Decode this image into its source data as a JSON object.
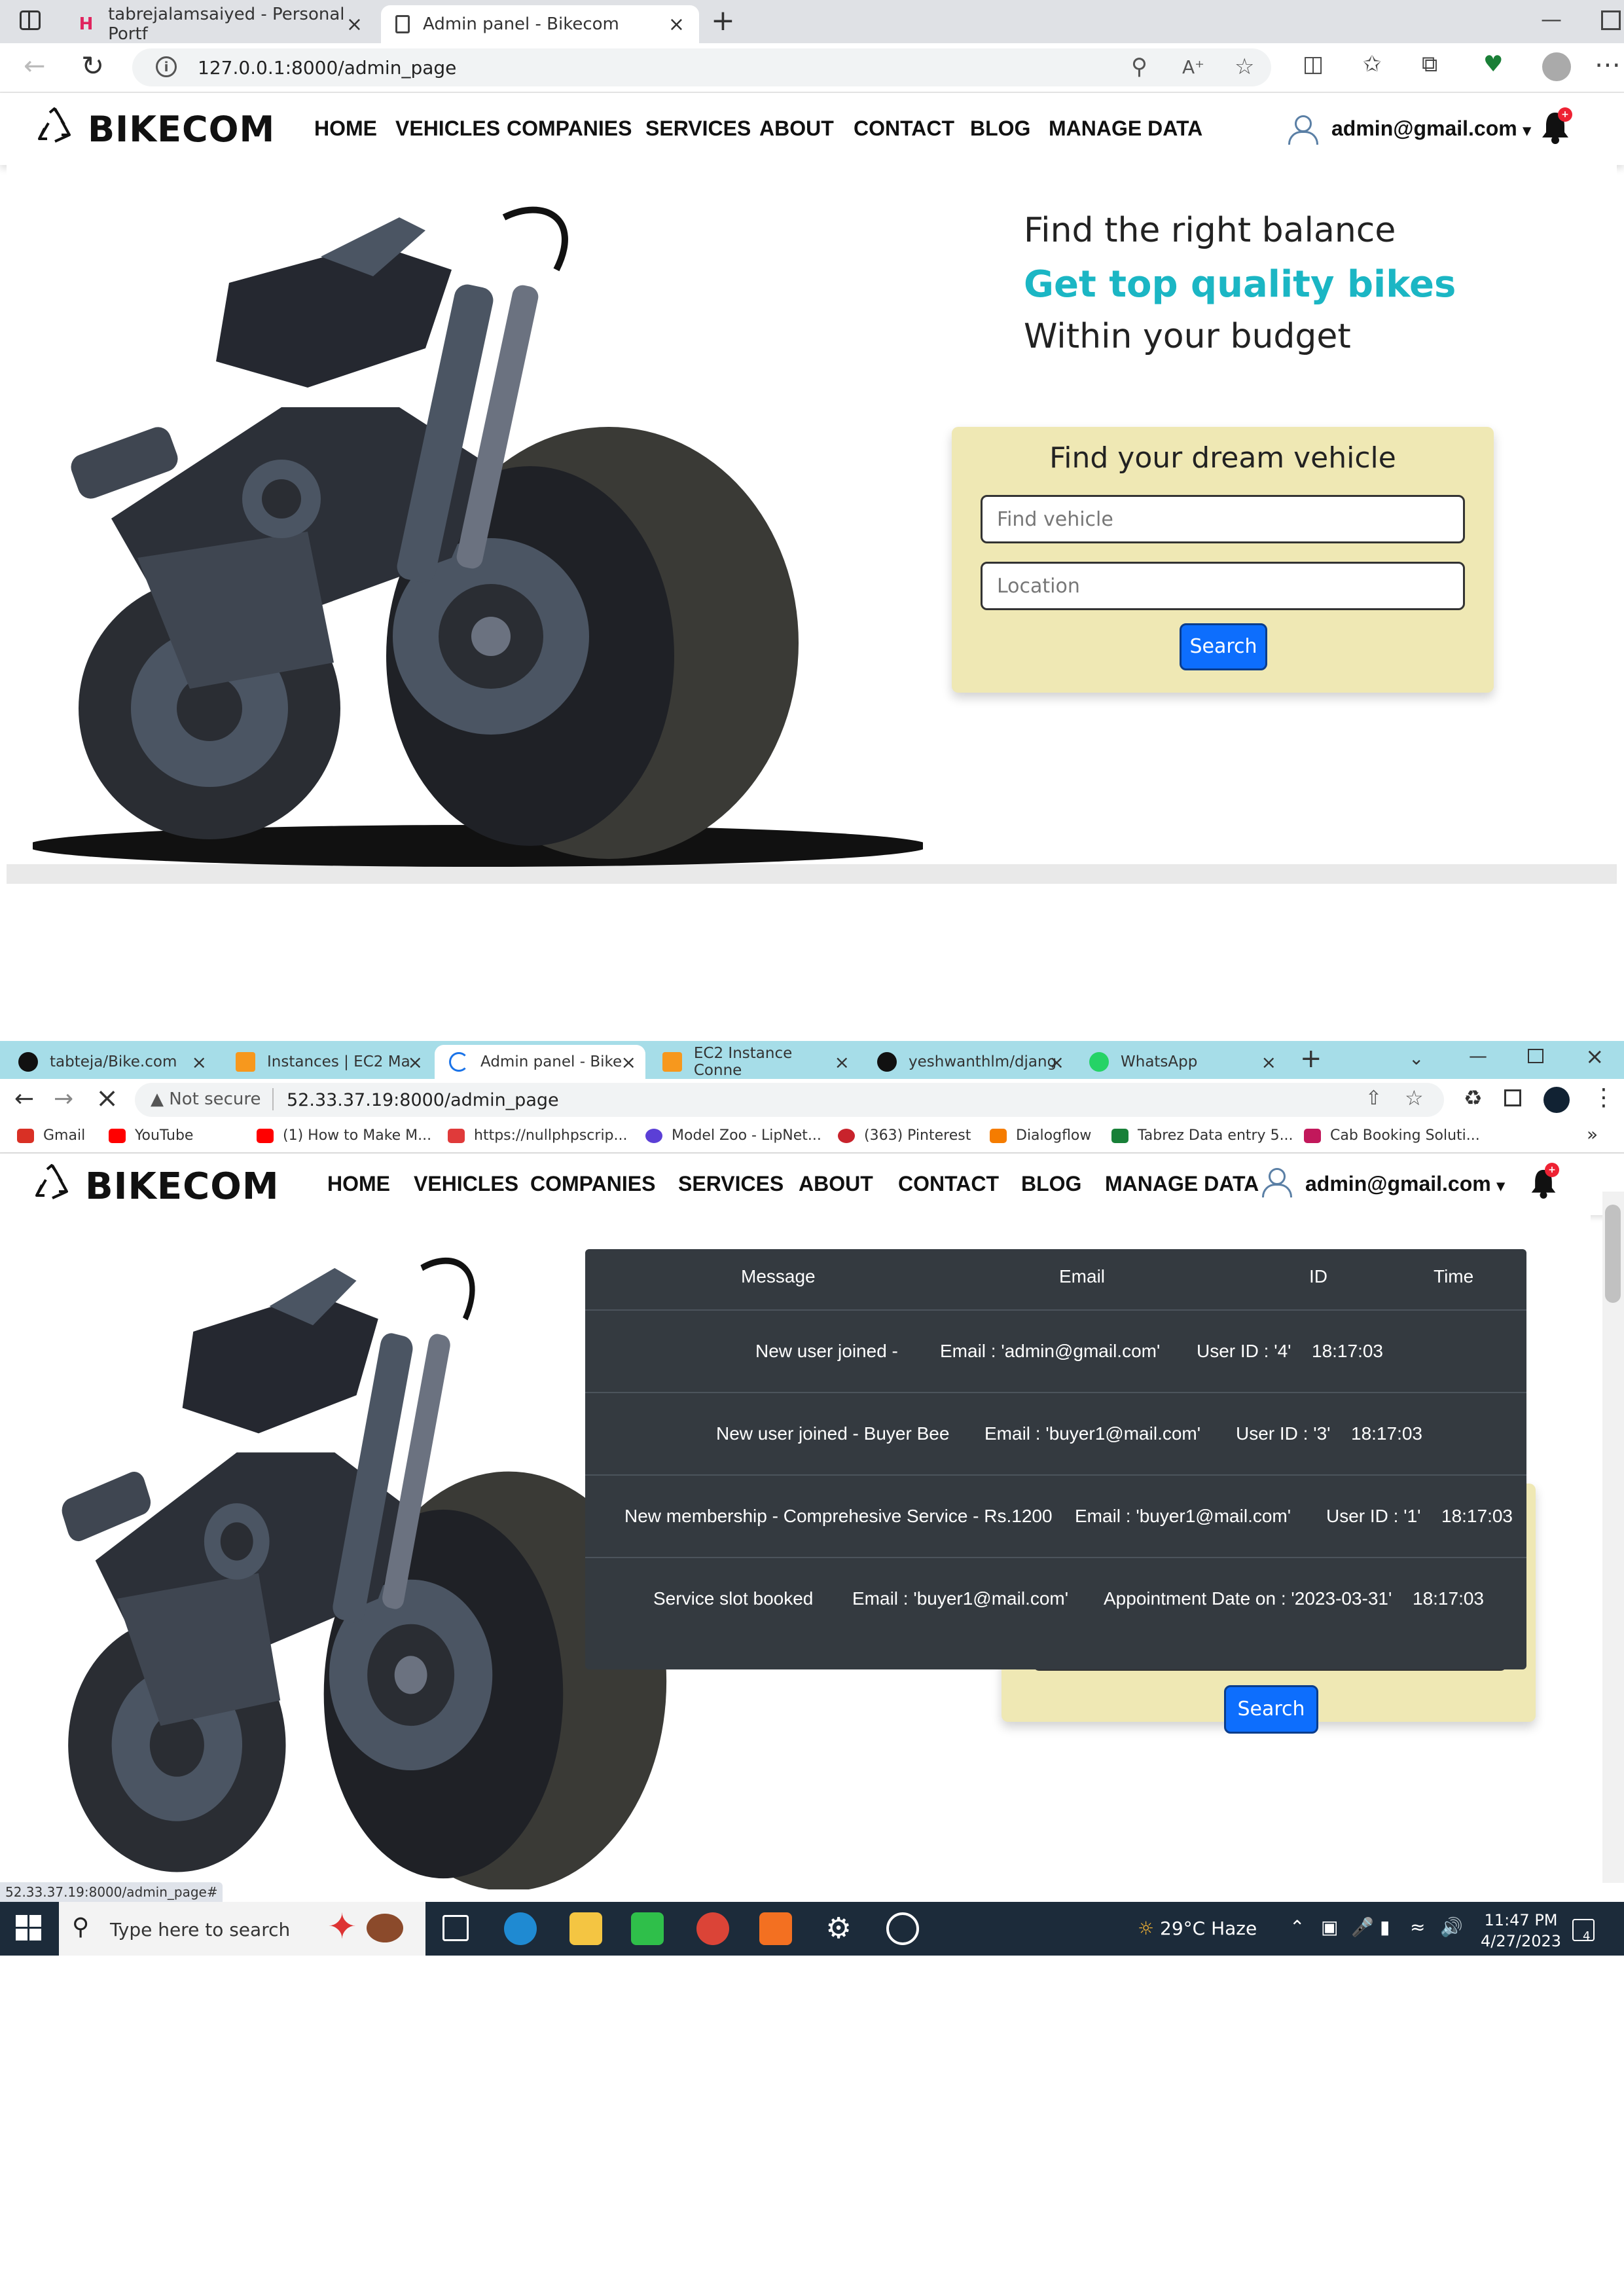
{
  "shot1": {
    "tabs": [
      {
        "title": "tabrejalamsaiyed - Personal Portf",
        "close": "×"
      },
      {
        "title": "Admin panel - Bikecom",
        "close": "×"
      }
    ],
    "new_tab": "+",
    "window_minimize": "—",
    "address": "127.0.0.1:8000/admin_page",
    "toolbar_icons": [
      "zoom-icon",
      "read-aloud-icon",
      "favorite-star-icon",
      "split-screen-icon",
      "favorites-icon",
      "collections-icon",
      "browser-essentials-icon",
      "profile-avatar",
      "more-icon"
    ]
  },
  "site": {
    "brand": "BIKECOM",
    "nav": [
      "HOME",
      "VEHICLES",
      "COMPANIES",
      "SERVICES",
      "ABOUT",
      "CONTACT",
      "BLOG",
      "MANAGE DATA"
    ],
    "user_email": "admin@gmail.com",
    "caret": "▾",
    "bell_badge": "+",
    "hero": {
      "line1": "Find the right balance",
      "line2": "Get top quality bikes",
      "line3": "Within your budget"
    },
    "finder": {
      "title": "Find your dream vehicle",
      "vehicle_placeholder": "Find vehicle",
      "location_placeholder": "Location",
      "search_label": "Search"
    }
  },
  "shot2": {
    "tabs": [
      {
        "title": "tabteja/Bike.com",
        "close": "×"
      },
      {
        "title": "Instances | EC2 Ma",
        "close": "×"
      },
      {
        "title": "Admin panel - Bike",
        "close": "×"
      },
      {
        "title": "EC2 Instance Conne",
        "close": "×"
      },
      {
        "title": "yeshwanthlm/djang",
        "close": "×"
      },
      {
        "title": "WhatsApp",
        "close": "×"
      }
    ],
    "new_tab": "+",
    "not_secure": "Not secure",
    "address": "52.33.37.19:8000/admin_page",
    "bookmarks": [
      {
        "label": "Gmail",
        "color": "#d93025"
      },
      {
        "label": "YouTube",
        "color": "#ff0000"
      },
      {
        "label": "(1) How to Make M...",
        "color": "#ff0000"
      },
      {
        "label": "https://nullphpscrip...",
        "color": "#e03a3a"
      },
      {
        "label": "Model Zoo - LipNet...",
        "color": "#5b3fd6"
      },
      {
        "label": "(363) Pinterest",
        "color": "#c8232c"
      },
      {
        "label": "Dialogflow",
        "color": "#f57c00"
      },
      {
        "label": "Tabrez Data entry 5...",
        "color": "#188038"
      },
      {
        "label": "Cab Booking Soluti...",
        "color": "#c2185b"
      }
    ],
    "bookmarks_more": "»",
    "status_url": "52.33.37.19:8000/admin_page#",
    "notifications": {
      "headers": [
        "Message",
        "Email",
        "ID",
        "Time"
      ],
      "rows": [
        {
          "message": "New user joined -",
          "email": "Email : 'admin@gmail.com'",
          "id": "User ID : '4'",
          "time": "18:17:03"
        },
        {
          "message": "New user joined - Buyer Bee",
          "email": "Email : 'buyer1@mail.com'",
          "id": "User ID : '3'",
          "time": "18:17:03"
        },
        {
          "message": "New membership - Comprehesive Service - Rs.1200",
          "email": "Email : 'buyer1@mail.com'",
          "id": "User ID : '1'",
          "time": "18:17:03"
        },
        {
          "message": "Service slot booked",
          "email": "Email : 'buyer1@mail.com'",
          "id": "Appointment Date on : '2023-03-31'",
          "time": "18:17:03"
        }
      ]
    },
    "taskbar": {
      "search_placeholder": "Type here to search",
      "weather": "29°C  Haze",
      "time": "11:47 PM",
      "date": "4/27/2023",
      "notification_count": "4"
    }
  }
}
